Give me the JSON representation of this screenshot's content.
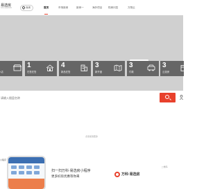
{
  "header": {
    "logo_text": "易选房",
    "logo_tagline": "有安心的选房体验",
    "city": "深圳",
    "nav": [
      {
        "label": "首页",
        "active": true
      },
      {
        "label": "市场新房"
      },
      {
        "label": "新房一"
      },
      {
        "label": "海外项目"
      },
      {
        "label": "购房问答"
      },
      {
        "label": "万物云"
      }
    ]
  },
  "banner": {
    "badge_text": "——"
  },
  "stats": [
    {
      "num": "",
      "label": "小店",
      "icon": "shop-icon"
    },
    {
      "num": "1",
      "label": "在售在售",
      "icon": "house-icon"
    },
    {
      "num": "4",
      "label": "新品在售",
      "icon": "building-icon"
    },
    {
      "num": "3",
      "label": "新开盘",
      "icon": "map-icon"
    },
    {
      "num": "3",
      "label": "付款",
      "icon": "car-icon"
    },
    {
      "num": "3",
      "label": "云选房",
      "icon": "calendar-icon"
    }
  ],
  "search": {
    "placeholder": "请输入楼盘名称"
  },
  "expand_label": "点击加载更多",
  "footer": {
    "section_label": "小程序",
    "promo_line1": "扫一扫万科·易选房小程序",
    "promo_line2": "更多好房优惠等你来",
    "brand_name": "万科·易选房",
    "qr_label": "二维码"
  },
  "colors": {
    "accent": "#e8412c",
    "banner_bg": "#d0d0d0",
    "stat_bg": "#666666"
  }
}
